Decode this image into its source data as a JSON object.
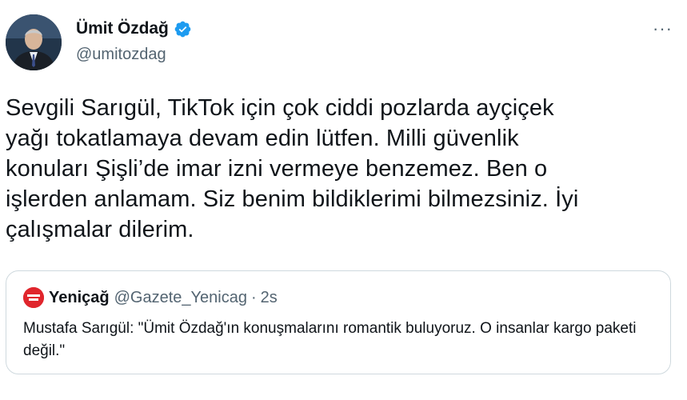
{
  "author": {
    "display_name": "Ümit Özdağ",
    "handle": "@umitozdag",
    "avatar_icon": "profile-photo",
    "verified_icon": "verified-badge-icon",
    "verified_color": "#1d9bf0"
  },
  "more_menu": {
    "label": "···"
  },
  "tweet": {
    "text": "Sevgili Sarıgül, TikTok için çok ciddi pozlarda ayçiçek\nyağı tokatlamaya devam edin lütfen. Milli güvenlik\nkonuları Şişli’de imar izni vermeye benzemez. Ben o\nişlerden anlamam. Siz benim bildiklerimi bilmezsiniz. İyi\nçalışmalar dilerim."
  },
  "quoted_tweet": {
    "logo_icon": "yenicag-logo-icon",
    "logo_color": "#e0252c",
    "display_name": "Yeniçağ",
    "handle": "@Gazete_Yenicag",
    "separator": "·",
    "time": "2s",
    "text": "Mustafa Sarıgül: \"Ümit Özdağ'ın konuşmalarını romantik buluyoruz. O insanlar kargo paketi değil.\""
  }
}
